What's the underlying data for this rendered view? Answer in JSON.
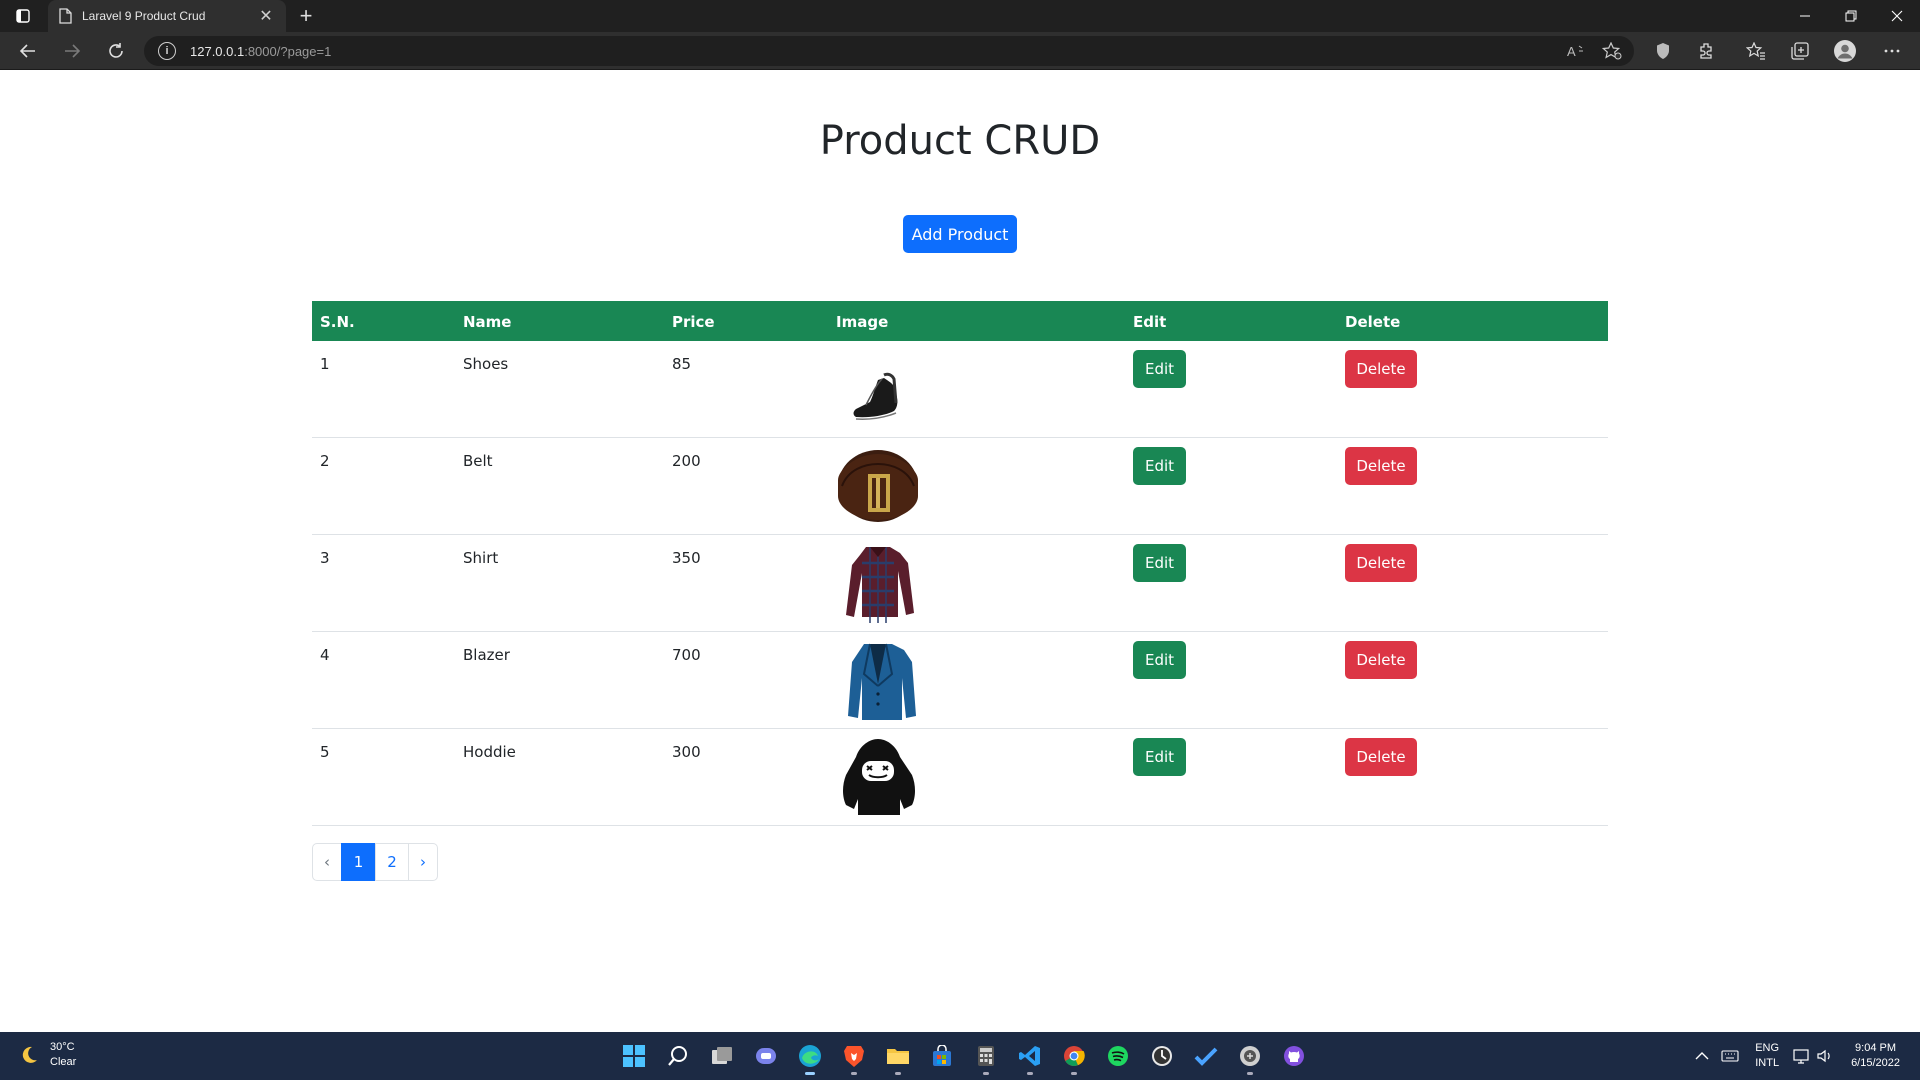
{
  "browser": {
    "tab_title": "Laravel 9 Product Crud",
    "new_tab_symbol": "+",
    "url_host": "127.0.0.1",
    "url_rest": ":8000/?page=1",
    "tab_close_symbol": "✕"
  },
  "page": {
    "title": "Product CRUD",
    "add_button_label": "Add Product"
  },
  "table": {
    "headers": [
      "S.N.",
      "Name",
      "Price",
      "Image",
      "Edit",
      "Delete"
    ],
    "rows": [
      {
        "sn": "1",
        "name": "Shoes",
        "price": "85",
        "image_icon": "shoe-image",
        "edit": "Edit",
        "delete": "Delete"
      },
      {
        "sn": "2",
        "name": "Belt",
        "price": "200",
        "image_icon": "belt-image",
        "edit": "Edit",
        "delete": "Delete"
      },
      {
        "sn": "3",
        "name": "Shirt",
        "price": "350",
        "image_icon": "shirt-image",
        "edit": "Edit",
        "delete": "Delete"
      },
      {
        "sn": "4",
        "name": "Blazer",
        "price": "700",
        "image_icon": "blazer-image",
        "edit": "Edit",
        "delete": "Delete"
      },
      {
        "sn": "5",
        "name": "Hoddie",
        "price": "300",
        "image_icon": "hoodie-image",
        "edit": "Edit",
        "delete": "Delete"
      }
    ]
  },
  "pagination": {
    "prev": "‹",
    "pages": [
      "1",
      "2"
    ],
    "active": "1",
    "next": "›"
  },
  "taskbar": {
    "weather_temp": "30°C",
    "weather_desc": "Clear",
    "lang": "ENG",
    "layout": "INTL",
    "time": "9:04 PM",
    "date": "6/15/2022"
  },
  "colors": {
    "primary": "#0d6efd",
    "success": "#198754",
    "danger": "#dc3545"
  }
}
